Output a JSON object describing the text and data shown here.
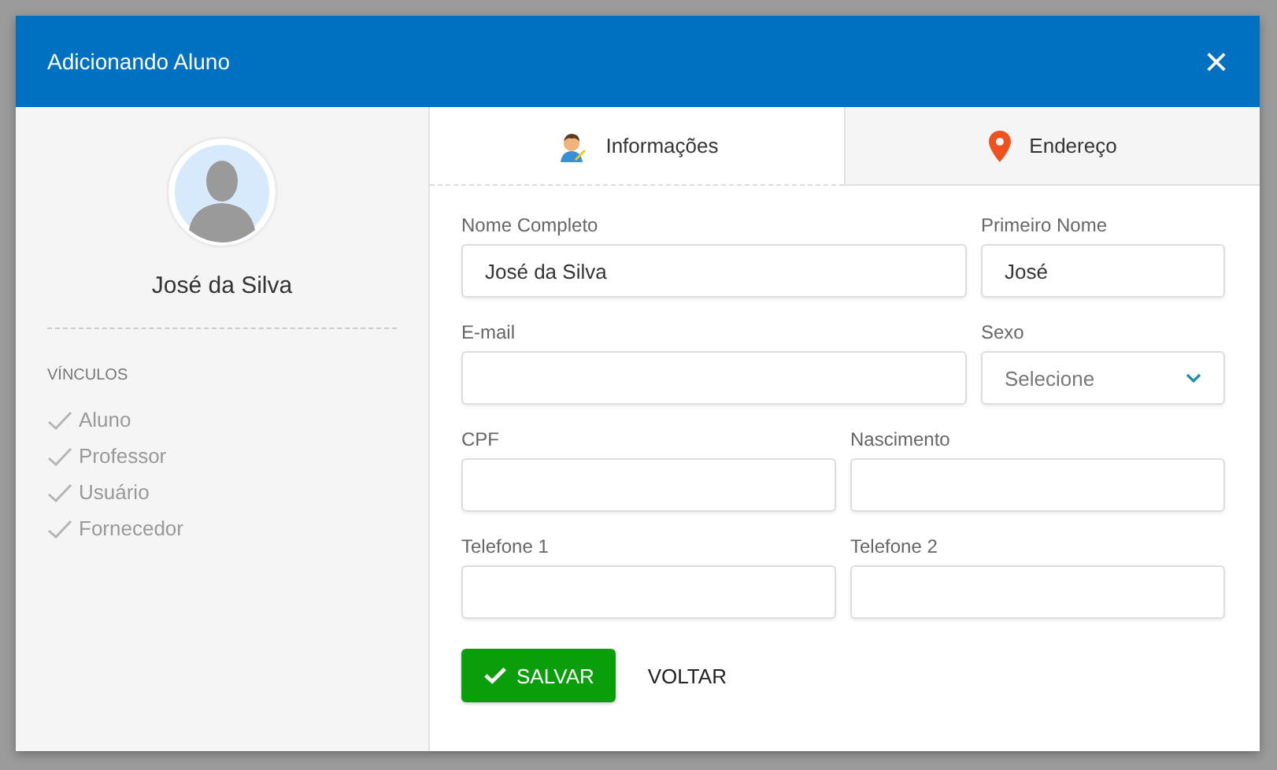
{
  "dialog": {
    "title": "Adicionando Aluno",
    "close": "×"
  },
  "profile": {
    "name": "José da Silva",
    "links_heading": "VÍNCULOS",
    "links": [
      {
        "label": "Aluno",
        "checked": false
      },
      {
        "label": "Professor",
        "checked": false
      },
      {
        "label": "Usuário",
        "checked": false
      },
      {
        "label": "Fornecedor",
        "checked": false
      }
    ]
  },
  "tabs": [
    {
      "label": "Informações",
      "kind": "person",
      "selected": true
    },
    {
      "label": "Endereço",
      "kind": "pin",
      "selected": false
    }
  ],
  "form": {
    "rows": [
      [
        {
          "label": "Nome Completo",
          "kind": "text",
          "value": "José da Silva"
        },
        {
          "label": "Primeiro Nome",
          "kind": "text",
          "value": "José"
        }
      ],
      [
        {
          "label": "E-mail",
          "kind": "text"
        },
        {
          "label": "Sexo",
          "kind": "select",
          "placeholder": "Selecione"
        }
      ],
      [
        {
          "label": "CPF",
          "kind": "text"
        },
        {
          "label": "Nascimento",
          "kind": "text"
        }
      ],
      [
        {
          "label": "Telefone 1",
          "kind": "text"
        },
        {
          "label": "Telefone 2",
          "kind": "text"
        }
      ]
    ]
  },
  "buttons": [
    {
      "label": "SALVAR",
      "kind": "primary"
    },
    {
      "label": "VOLTAR",
      "kind": "link"
    }
  ]
}
